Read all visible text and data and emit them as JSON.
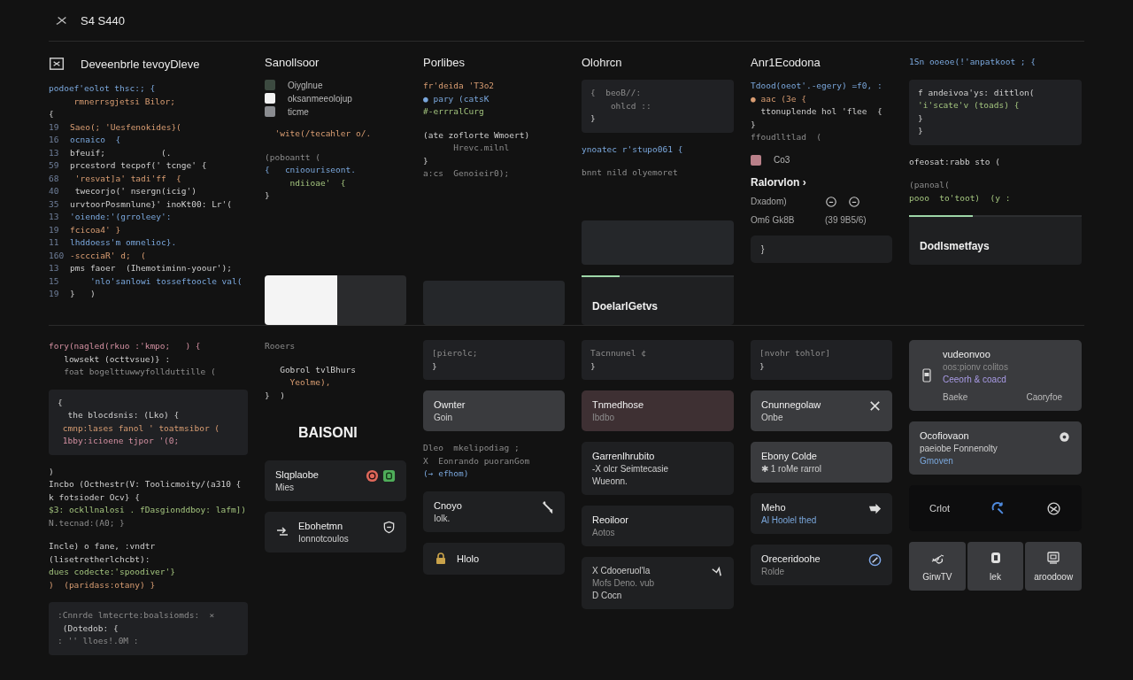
{
  "header": {
    "title": "S4 S440"
  },
  "top": [
    {
      "blocks": [
        {
          "kind": "heading-icon",
          "text": "Deveenbrle tevoyDleve"
        },
        {
          "kind": "code",
          "lines": [
            {
              "text": "podoef'eolot thsc:; {",
              "kind": "keyword"
            },
            {
              "text": "     rmnerrsgjetsi Bilor;",
              "kind": "string"
            },
            {
              "text": "{",
              "kind": "plain"
            },
            {
              "num": "19",
              "text": "Saeo(; 'Uesfenokides}(",
              "kind": "string"
            },
            {
              "num": "16",
              "text": "ocnaico  {",
              "kind": "keyword"
            },
            {
              "num": "13",
              "text": "bfeuif;           (.",
              "kind": "plain"
            },
            {
              "num": "59",
              "text": "prcestord tecpof(' tcnge' {",
              "kind": "plain"
            },
            {
              "num": "68",
              "text": " 'resvat]a' tadi'ff  {",
              "kind": "string"
            },
            {
              "num": "40",
              "text": " twecorjo(' nsergn(icig')",
              "kind": "plain"
            },
            {
              "num": "35",
              "text": "urvtoorPosmnlune}' inoKt00: Lr'(",
              "kind": "plain"
            },
            {
              "num": "13",
              "text": "'oiende:'(grroleey':",
              "kind": "keyword"
            },
            {
              "num": "19",
              "text": "fcicoa4' }",
              "kind": "string"
            },
            {
              "num": "11",
              "text": "lhddoess'm omnelioc}.",
              "kind": "keyword"
            },
            {
              "num": "160",
              "text": "-sccciaR' d;  (",
              "kind": "string"
            },
            {
              "num": "13",
              "text": "pms faoer  (Ihemotiminn-yoour');",
              "kind": "plain"
            },
            {
              "num": "15",
              "text": "    'nlo'sanlowi tosseftoocle val(",
              "kind": "keyword"
            },
            {
              "num": "19",
              "text": "}   )",
              "kind": "plain"
            }
          ]
        }
      ]
    },
    {
      "blocks": [
        {
          "kind": "heading",
          "text": "Sanollsoor"
        },
        {
          "kind": "swatches",
          "items": [
            {
              "color": "#3c4a40",
              "label": "Oiyglnue"
            },
            {
              "color": "#f2f2f2",
              "label": "oksanmeeolojup"
            },
            {
              "color": "#8a8c90",
              "label": "ticme"
            }
          ]
        },
        {
          "kind": "code",
          "lines": [
            {
              "text": "  'wite(/tecahler o/.",
              "kind": "string"
            }
          ]
        },
        {
          "kind": "code",
          "lines": [
            {
              "text": "(poboantt (",
              "kind": "comment"
            },
            {
              "text": "{   cnioouriseont.",
              "kind": "keyword"
            },
            {
              "text": "     ndiioae'  {",
              "kind": "function"
            },
            {
              "text": "}",
              "kind": "plain"
            }
          ]
        },
        {
          "kind": "preview"
        }
      ]
    },
    {
      "blocks": [
        {
          "kind": "heading",
          "text": "Porlibes"
        },
        {
          "kind": "code",
          "lines": [
            {
              "text": "fr'deida 'T3o2",
              "kind": "string"
            },
            {
              "text": "● pary (catsK",
              "kind": "keyword"
            },
            {
              "text": "#-errralCurg",
              "kind": "function"
            }
          ]
        },
        {
          "kind": "code",
          "lines": [
            {
              "text": "(ate zoflorte Wmoert)",
              "kind": "plain"
            },
            {
              "text": "      Hrevc.milnl",
              "kind": "comment"
            },
            {
              "text": "}",
              "kind": "plain"
            },
            {
              "text": "a:cs  Genoieir0);",
              "kind": "comment"
            }
          ]
        },
        {
          "kind": "panel"
        }
      ]
    },
    {
      "blocks": [
        {
          "kind": "heading",
          "text": "Olohrcn"
        },
        {
          "kind": "code-box",
          "lines": [
            {
              "text": "{  beoB//:",
              "kind": "comment"
            },
            {
              "text": "    ohlcd ::",
              "kind": "comment"
            },
            {
              "text": "}",
              "kind": "plain"
            }
          ]
        },
        {
          "kind": "code",
          "lines": [
            {
              "text": "ynoatec r'stupo061 {",
              "kind": "keyword"
            }
          ]
        },
        {
          "kind": "code",
          "lines": [
            {
              "text": "bnnt nild olyemoret",
              "kind": "comment"
            }
          ]
        },
        {
          "kind": "panel"
        },
        {
          "kind": "progress-card",
          "title": "DoelarlGetvs",
          "level": 0.25
        }
      ]
    },
    {
      "blocks": [
        {
          "kind": "heading",
          "text": "Anr1Ecodona"
        },
        {
          "kind": "code",
          "lines": [
            {
              "text": "Tdood(oeot'.-egery) =f0, :",
              "kind": "keyword"
            },
            {
              "text": "● aac (3e {",
              "kind": "string"
            },
            {
              "text": "  ttonuplende hol 'flee  {",
              "kind": "plain"
            },
            {
              "text": "}",
              "kind": "plain"
            },
            {
              "text": "ffoudlltlad  (",
              "kind": "comment"
            }
          ]
        },
        {
          "kind": "swatches",
          "items": [
            {
              "color": "#b98089",
              "label": "Co3"
            }
          ]
        },
        {
          "kind": "kv",
          "title": "Ralorvlon ›",
          "rows": [
            {
              "label": "Dxadom)"
            },
            {
              "label": "Om6 Gk8B",
              "value": "(39 9B5/6)"
            }
          ]
        },
        {
          "kind": "card",
          "lines": [
            {
              "text": "}",
              "kind": "plain"
            }
          ]
        }
      ]
    },
    {
      "blocks": [
        {
          "kind": "code",
          "lines": [
            {
              "text": "1Sn ooeoe(!'anpatkoot ; {",
              "kind": "keyword"
            }
          ]
        },
        {
          "kind": "code-box",
          "lines": [
            {
              "text": "f andeivoa'ys: dittlon(",
              "kind": "plain"
            },
            {
              "text": "'i'scate'v (toads) {",
              "kind": "function"
            },
            {
              "text": "}",
              "kind": "plain"
            },
            {
              "text": "}",
              "kind": "plain"
            }
          ]
        },
        {
          "kind": "code",
          "lines": [
            {
              "text": "ofeosat:rabb sto (",
              "kind": "plain"
            }
          ]
        },
        {
          "kind": "code",
          "lines": [
            {
              "text": "(panoal(",
              "kind": "comment"
            },
            {
              "text": "pooo  to'toot)  (y :",
              "kind": "function"
            }
          ]
        },
        {
          "kind": "progress-card",
          "title": "Dodlsmetfays",
          "level": 0.37
        }
      ]
    }
  ],
  "bottom": [
    {
      "blocks": [
        {
          "kind": "code",
          "lines": [
            {
              "text": "fory(nagled(rkuo :'kmpo;   ) {",
              "kind": "number"
            },
            {
              "text": "   lowsekt (octtvsue)} :",
              "kind": "plain"
            },
            {
              "text": "   foat bogelttuwwyfollduttille (",
              "kind": "comment"
            }
          ]
        },
        {
          "kind": "code-box",
          "lines": [
            {
              "text": "{",
              "kind": "plain"
            },
            {
              "text": "  the blocdsnis: (Lko) {",
              "kind": "plain"
            },
            {
              "text": " cmnp:lases fanol ' toatmsibor (",
              "kind": "string"
            },
            {
              "text": " 1bby:icioene tjpor '(0;",
              "kind": "number"
            }
          ]
        },
        {
          "kind": "code",
          "lines": [
            {
              "text": ")",
              "kind": "plain"
            },
            {
              "text": "Incbo (Octhestr(V: Toolicmoity/(a310 {",
              "kind": "plain"
            },
            {
              "text": "k fotsioder Ocv} {",
              "kind": "plain"
            },
            {
              "text": "$3: ockllnalosi . fDasgionddboy: lafm])",
              "kind": "function"
            },
            {
              "text": "N.tecnad:(A0; }",
              "kind": "comment"
            }
          ]
        },
        {
          "kind": "code",
          "lines": [
            {
              "text": "Incle) o fane, :vndtr (lisetretherlchcbt):",
              "kind": "plain"
            },
            {
              "text": "dues codecte:'spoodiver'}",
              "kind": "function"
            },
            {
              "text": ")  (paridass:otany) }",
              "kind": "string"
            }
          ]
        },
        {
          "kind": "code-box",
          "lines": [
            {
              "text": ":Cnnrde lmtecrte:boalsiomds:  ×",
              "kind": "comment"
            },
            {
              "text": " (Dotedob: {",
              "kind": "plain"
            },
            {
              "text": ": '' lloes!.0M :",
              "kind": "comment"
            }
          ]
        }
      ]
    },
    {
      "blocks": [
        {
          "kind": "code",
          "lines": [
            {
              "text": "Rooers",
              "kind": "comment"
            }
          ]
        },
        {
          "kind": "code",
          "lines": [
            {
              "text": "   Gobrol tvlBhurs",
              "kind": "plain"
            },
            {
              "text": "     Yeolme),",
              "kind": "string"
            },
            {
              "text": "}  )",
              "kind": "plain"
            }
          ]
        },
        {
          "kind": "bigtext",
          "text": "BAISONI"
        },
        {
          "kind": "card",
          "title": "Slqplaobe",
          "lines": [
            {
              "text": "Mies",
              "kind": "plain"
            }
          ]
        },
        {
          "kind": "card",
          "title": "Ebohetmn",
          "lines": [
            {
              "text": "Ionnotcoulos",
              "kind": "plain"
            }
          ]
        }
      ]
    },
    {
      "blocks": [
        {
          "kind": "code-box",
          "lines": [
            {
              "text": "[pierolc;",
              "kind": "comment"
            },
            {
              "text": "}",
              "kind": "plain"
            }
          ]
        },
        {
          "kind": "card-raised",
          "title": "Ownter",
          "lines": [
            {
              "text": "Goin",
              "kind": "plain"
            }
          ]
        },
        {
          "kind": "code",
          "lines": [
            {
              "text": "Dleo  mkelipodiag ;",
              "kind": "comment"
            },
            {
              "text": "X  Eonrando puoranGom",
              "kind": "comment"
            },
            {
              "text": "(→ efhom)",
              "kind": "keyword"
            }
          ]
        },
        {
          "kind": "card",
          "title": "Cnoyo",
          "lines": [
            {
              "text": "Iolk.",
              "kind": "plain"
            }
          ]
        },
        {
          "kind": "card",
          "title": "Hlolo"
        }
      ]
    },
    {
      "blocks": [
        {
          "kind": "code-box",
          "lines": [
            {
              "text": "Tacnnunel ¢",
              "kind": "comment"
            },
            {
              "text": "}",
              "kind": "plain"
            }
          ]
        },
        {
          "kind": "card-rose",
          "title": "Tnmedhose",
          "lines": [
            {
              "text": "Ibdbo",
              "kind": "comment"
            }
          ]
        },
        {
          "kind": "card",
          "title": "Garrenlhrubito",
          "lines": [
            {
              "text": "-X olcr Seimtecasie",
              "kind": "plain"
            },
            {
              "text": "Wueonn.",
              "kind": "plain"
            }
          ]
        },
        {
          "kind": "card",
          "title": "Reoiloor",
          "lines": [
            {
              "text": "Aotos",
              "kind": "comment"
            }
          ]
        },
        {
          "kind": "card",
          "lines": [
            {
              "text": "X  Cdooeruol'la",
              "kind": "plain"
            },
            {
              "text": "    Mofs Deno. vub",
              "kind": "comment"
            },
            {
              "text": "D  Cocn",
              "kind": "plain"
            }
          ]
        }
      ]
    },
    {
      "blocks": [
        {
          "kind": "code-box",
          "lines": [
            {
              "text": "[nvohr tohlor]",
              "kind": "comment"
            },
            {
              "text": "}",
              "kind": "plain"
            }
          ]
        },
        {
          "kind": "card-raised",
          "title": "Cnunnegolaw",
          "lines": [
            {
              "text": "Onbe",
              "kind": "plain"
            }
          ]
        },
        {
          "kind": "card-raised",
          "title": "Ebony Colde",
          "lines": [
            {
              "text": "✱ 1 roMe rarrol",
              "kind": "plain"
            }
          ]
        },
        {
          "kind": "card",
          "title": "Meho",
          "lines": [
            {
              "text": "Al Hoolel thed",
              "kind": "keyword"
            }
          ]
        },
        {
          "kind": "card",
          "title": "Oreceridoohe",
          "lines": [
            {
              "text": "Rolde",
              "kind": "comment"
            }
          ]
        }
      ]
    },
    {
      "blocks": [
        {
          "kind": "card-raised",
          "title": "vudeonvoo",
          "lines": [
            {
              "text": "oos:pionv colitos",
              "kind": "comment"
            },
            {
              "text": "Ceeorh & coacd",
              "kind": "tag"
            }
          ],
          "footer": [
            "Baeke",
            "Caoryfoe"
          ]
        },
        {
          "kind": "card-raised",
          "title": "Ocofiovaon",
          "lines": [
            {
              "text": "paeiobe Fonnenolty",
              "kind": "plain"
            },
            {
              "text": "Gmoven",
              "kind": "keyword"
            }
          ]
        },
        {
          "kind": "icon-row",
          "text": "Crlot"
        },
        {
          "kind": "buttons",
          "items": [
            "GirwTV",
            "lek",
            "aroodoow"
          ]
        }
      ]
    }
  ]
}
